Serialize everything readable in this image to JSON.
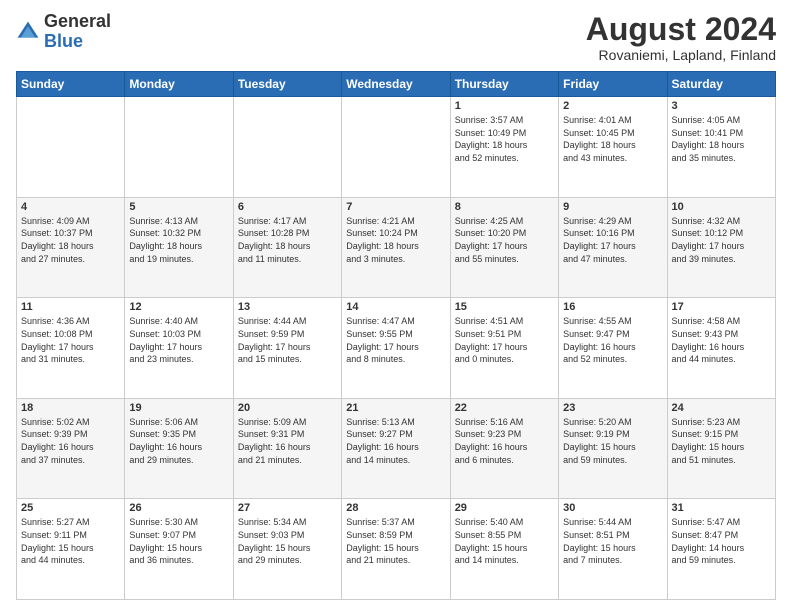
{
  "header": {
    "logo_general": "General",
    "logo_blue": "Blue",
    "month_year": "August 2024",
    "location": "Rovaniemi, Lapland, Finland"
  },
  "weekdays": [
    "Sunday",
    "Monday",
    "Tuesday",
    "Wednesday",
    "Thursday",
    "Friday",
    "Saturday"
  ],
  "weeks": [
    [
      {
        "day": "",
        "info": ""
      },
      {
        "day": "",
        "info": ""
      },
      {
        "day": "",
        "info": ""
      },
      {
        "day": "",
        "info": ""
      },
      {
        "day": "1",
        "info": "Sunrise: 3:57 AM\nSunset: 10:49 PM\nDaylight: 18 hours\nand 52 minutes."
      },
      {
        "day": "2",
        "info": "Sunrise: 4:01 AM\nSunset: 10:45 PM\nDaylight: 18 hours\nand 43 minutes."
      },
      {
        "day": "3",
        "info": "Sunrise: 4:05 AM\nSunset: 10:41 PM\nDaylight: 18 hours\nand 35 minutes."
      }
    ],
    [
      {
        "day": "4",
        "info": "Sunrise: 4:09 AM\nSunset: 10:37 PM\nDaylight: 18 hours\nand 27 minutes."
      },
      {
        "day": "5",
        "info": "Sunrise: 4:13 AM\nSunset: 10:32 PM\nDaylight: 18 hours\nand 19 minutes."
      },
      {
        "day": "6",
        "info": "Sunrise: 4:17 AM\nSunset: 10:28 PM\nDaylight: 18 hours\nand 11 minutes."
      },
      {
        "day": "7",
        "info": "Sunrise: 4:21 AM\nSunset: 10:24 PM\nDaylight: 18 hours\nand 3 minutes."
      },
      {
        "day": "8",
        "info": "Sunrise: 4:25 AM\nSunset: 10:20 PM\nDaylight: 17 hours\nand 55 minutes."
      },
      {
        "day": "9",
        "info": "Sunrise: 4:29 AM\nSunset: 10:16 PM\nDaylight: 17 hours\nand 47 minutes."
      },
      {
        "day": "10",
        "info": "Sunrise: 4:32 AM\nSunset: 10:12 PM\nDaylight: 17 hours\nand 39 minutes."
      }
    ],
    [
      {
        "day": "11",
        "info": "Sunrise: 4:36 AM\nSunset: 10:08 PM\nDaylight: 17 hours\nand 31 minutes."
      },
      {
        "day": "12",
        "info": "Sunrise: 4:40 AM\nSunset: 10:03 PM\nDaylight: 17 hours\nand 23 minutes."
      },
      {
        "day": "13",
        "info": "Sunrise: 4:44 AM\nSunset: 9:59 PM\nDaylight: 17 hours\nand 15 minutes."
      },
      {
        "day": "14",
        "info": "Sunrise: 4:47 AM\nSunset: 9:55 PM\nDaylight: 17 hours\nand 8 minutes."
      },
      {
        "day": "15",
        "info": "Sunrise: 4:51 AM\nSunset: 9:51 PM\nDaylight: 17 hours\nand 0 minutes."
      },
      {
        "day": "16",
        "info": "Sunrise: 4:55 AM\nSunset: 9:47 PM\nDaylight: 16 hours\nand 52 minutes."
      },
      {
        "day": "17",
        "info": "Sunrise: 4:58 AM\nSunset: 9:43 PM\nDaylight: 16 hours\nand 44 minutes."
      }
    ],
    [
      {
        "day": "18",
        "info": "Sunrise: 5:02 AM\nSunset: 9:39 PM\nDaylight: 16 hours\nand 37 minutes."
      },
      {
        "day": "19",
        "info": "Sunrise: 5:06 AM\nSunset: 9:35 PM\nDaylight: 16 hours\nand 29 minutes."
      },
      {
        "day": "20",
        "info": "Sunrise: 5:09 AM\nSunset: 9:31 PM\nDaylight: 16 hours\nand 21 minutes."
      },
      {
        "day": "21",
        "info": "Sunrise: 5:13 AM\nSunset: 9:27 PM\nDaylight: 16 hours\nand 14 minutes."
      },
      {
        "day": "22",
        "info": "Sunrise: 5:16 AM\nSunset: 9:23 PM\nDaylight: 16 hours\nand 6 minutes."
      },
      {
        "day": "23",
        "info": "Sunrise: 5:20 AM\nSunset: 9:19 PM\nDaylight: 15 hours\nand 59 minutes."
      },
      {
        "day": "24",
        "info": "Sunrise: 5:23 AM\nSunset: 9:15 PM\nDaylight: 15 hours\nand 51 minutes."
      }
    ],
    [
      {
        "day": "25",
        "info": "Sunrise: 5:27 AM\nSunset: 9:11 PM\nDaylight: 15 hours\nand 44 minutes."
      },
      {
        "day": "26",
        "info": "Sunrise: 5:30 AM\nSunset: 9:07 PM\nDaylight: 15 hours\nand 36 minutes."
      },
      {
        "day": "27",
        "info": "Sunrise: 5:34 AM\nSunset: 9:03 PM\nDaylight: 15 hours\nand 29 minutes."
      },
      {
        "day": "28",
        "info": "Sunrise: 5:37 AM\nSunset: 8:59 PM\nDaylight: 15 hours\nand 21 minutes."
      },
      {
        "day": "29",
        "info": "Sunrise: 5:40 AM\nSunset: 8:55 PM\nDaylight: 15 hours\nand 14 minutes."
      },
      {
        "day": "30",
        "info": "Sunrise: 5:44 AM\nSunset: 8:51 PM\nDaylight: 15 hours\nand 7 minutes."
      },
      {
        "day": "31",
        "info": "Sunrise: 5:47 AM\nSunset: 8:47 PM\nDaylight: 14 hours\nand 59 minutes."
      }
    ]
  ]
}
